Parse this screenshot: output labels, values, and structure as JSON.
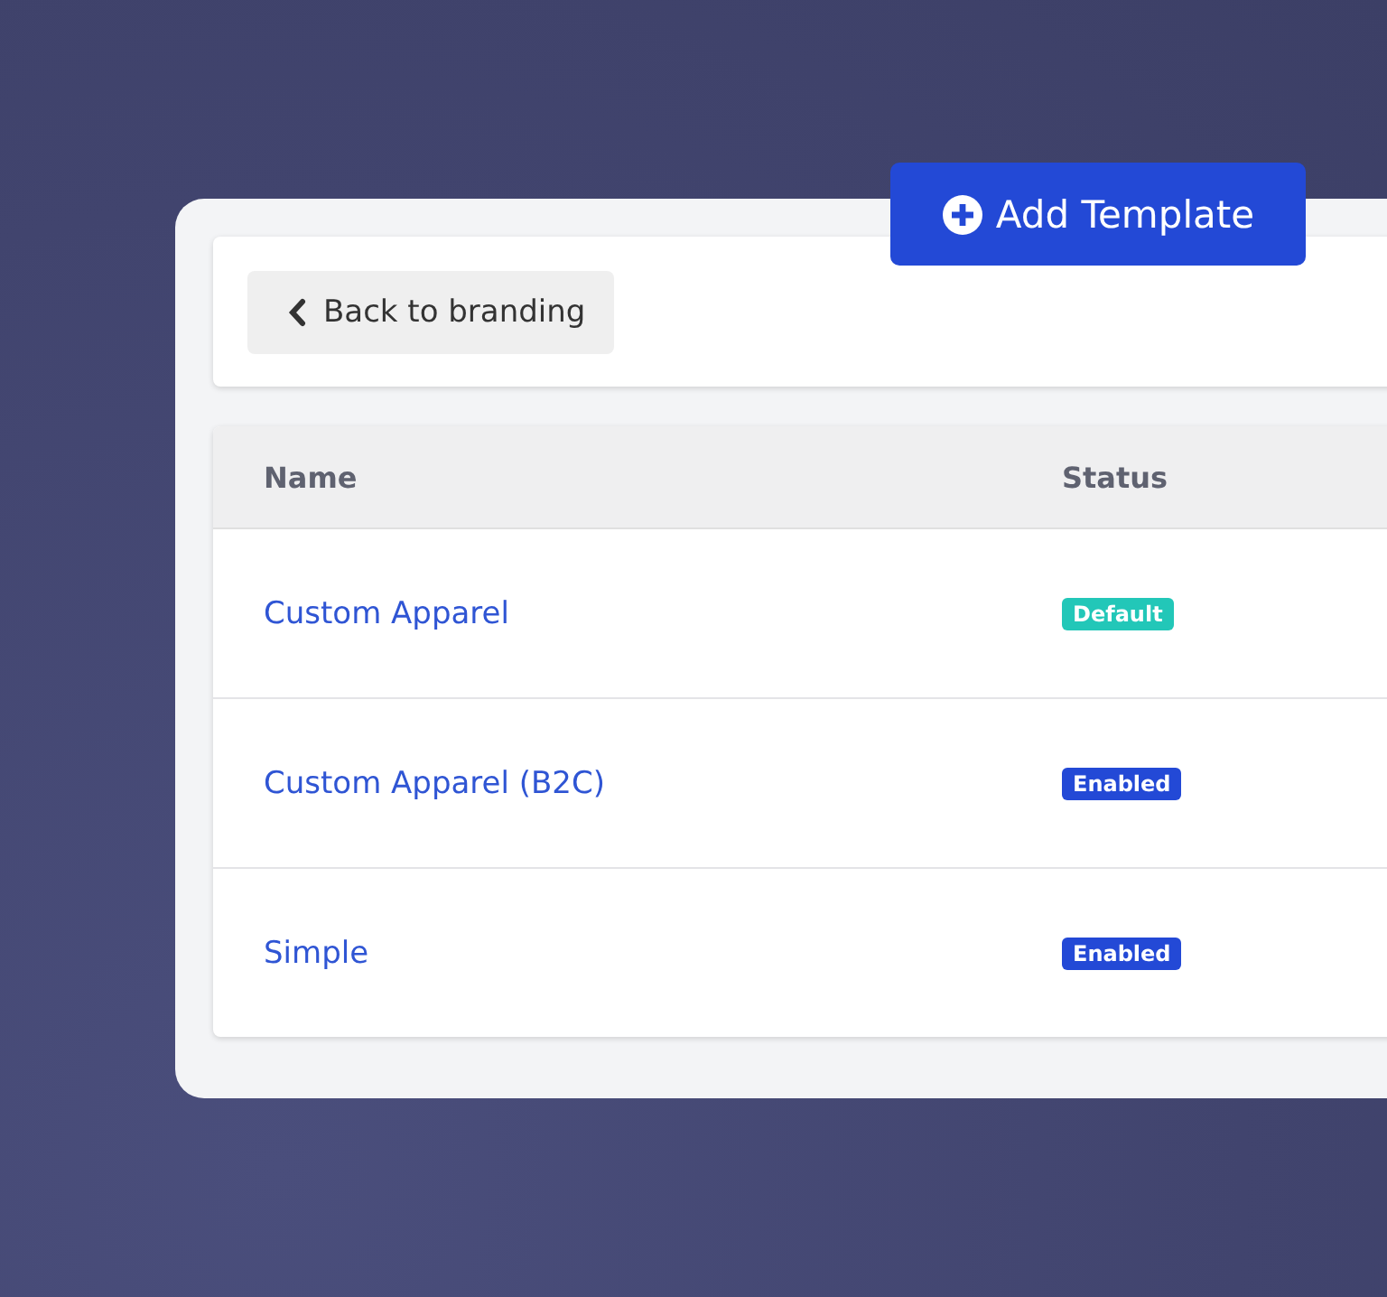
{
  "add_button": {
    "label": "Add Template"
  },
  "back_button": {
    "label": "Back to branding"
  },
  "table": {
    "columns": [
      "Name",
      "Status"
    ],
    "rows": [
      {
        "name": "Custom Apparel",
        "status": "Default",
        "color": "#22c7b8"
      },
      {
        "name": "Custom Apparel (B2C)",
        "status": "Enabled",
        "color": "#2349d6"
      },
      {
        "name": "Simple",
        "status": "Enabled",
        "color": "#2349d6"
      }
    ]
  }
}
